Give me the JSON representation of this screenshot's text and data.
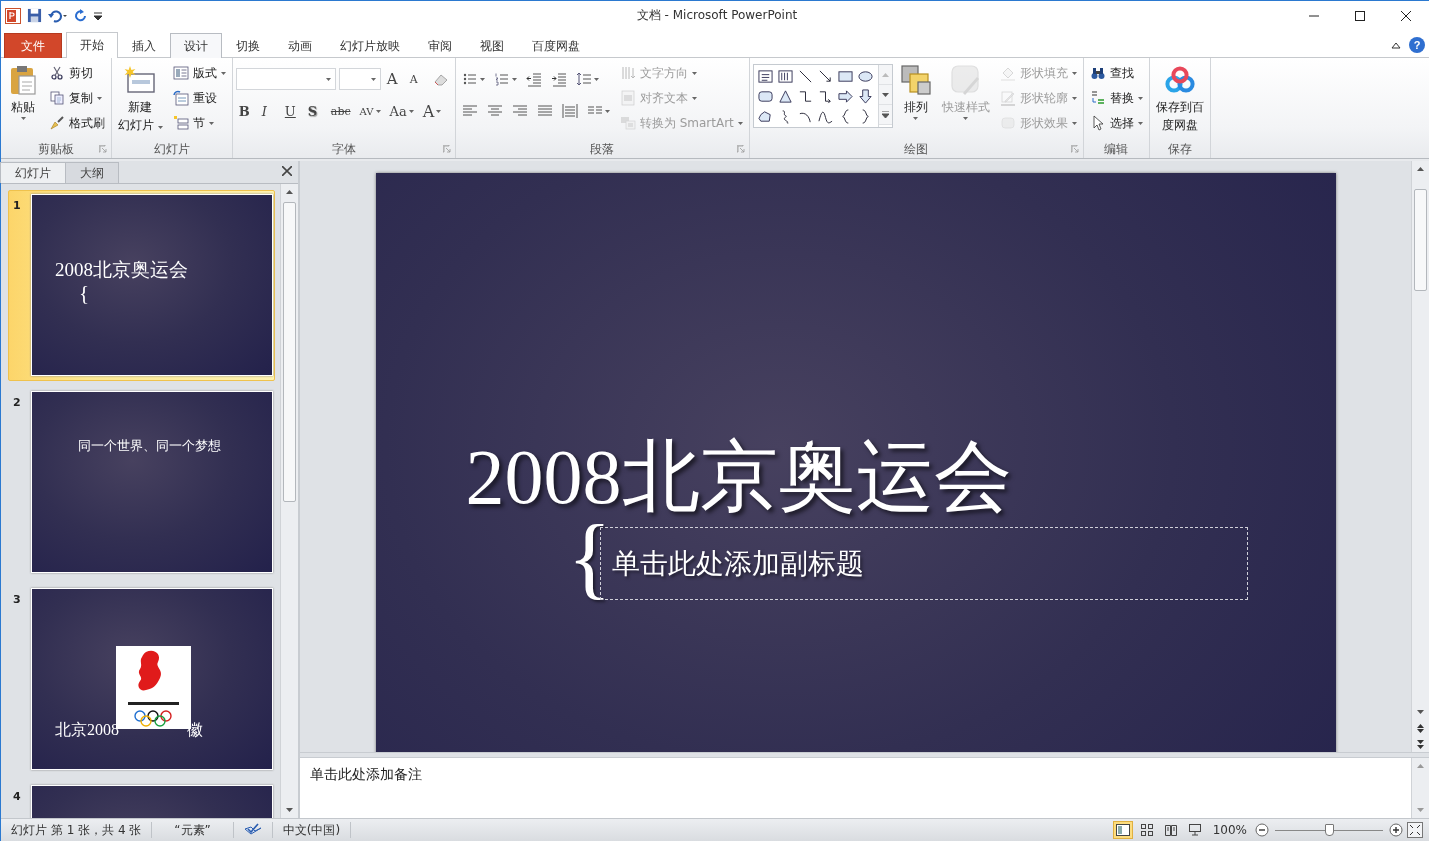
{
  "window": {
    "title": "文档 - Microsoft PowerPoint",
    "help": "?"
  },
  "tabs": [
    {
      "label": "文件",
      "kind": "file",
      "selected": false,
      "hovered": false
    },
    {
      "label": "开始",
      "kind": "tab",
      "selected": true,
      "hovered": false
    },
    {
      "label": "插入",
      "kind": "tab",
      "selected": false,
      "hovered": false
    },
    {
      "label": "设计",
      "kind": "tab",
      "selected": false,
      "hovered": true
    },
    {
      "label": "切换",
      "kind": "tab",
      "selected": false,
      "hovered": false
    },
    {
      "label": "动画",
      "kind": "tab",
      "selected": false,
      "hovered": false
    },
    {
      "label": "幻灯片放映",
      "kind": "tab",
      "selected": false,
      "hovered": false
    },
    {
      "label": "审阅",
      "kind": "tab",
      "selected": false,
      "hovered": false
    },
    {
      "label": "视图",
      "kind": "tab",
      "selected": false,
      "hovered": false
    },
    {
      "label": "百度网盘",
      "kind": "tab",
      "selected": false,
      "hovered": false
    }
  ],
  "ribbon": {
    "groups": [
      {
        "label": "剪贴板",
        "launcher": true,
        "items": [
          {
            "kind": "large",
            "lines": [
              "粘贴"
            ],
            "dropdown": true,
            "disabled": false
          },
          {
            "kind": "small",
            "label": "剪切",
            "dropdown": false,
            "disabled": false
          },
          {
            "kind": "small",
            "label": "复制",
            "dropdown": true,
            "disabled": false
          },
          {
            "kind": "small",
            "label": "格式刷",
            "dropdown": false,
            "disabled": false
          }
        ]
      },
      {
        "label": "幻灯片",
        "launcher": false,
        "items": [
          {
            "kind": "large",
            "lines": [
              "新建",
              "幻灯片"
            ],
            "dropdown": true,
            "disabled": false
          },
          {
            "kind": "small",
            "label": "版式",
            "dropdown": true,
            "disabled": false
          },
          {
            "kind": "small",
            "label": "重设",
            "dropdown": false,
            "disabled": false
          },
          {
            "kind": "small",
            "label": "节",
            "dropdown": true,
            "disabled": false
          }
        ]
      },
      {
        "label": "字体",
        "launcher": true,
        "upper": [
          {
            "kind": "font-field"
          },
          {
            "kind": "size-field"
          },
          {
            "kind": "grow",
            "label": "A"
          },
          {
            "kind": "shrink",
            "label": "A"
          },
          {
            "kind": "icon",
            "dropdown": false
          }
        ],
        "lower": [
          {
            "kind": "bold",
            "label": "B"
          },
          {
            "kind": "italic",
            "label": "I"
          },
          {
            "kind": "underline",
            "label": "U"
          },
          {
            "kind": "shadow",
            "label": "S"
          },
          {
            "kind": "strike",
            "label": "abc"
          },
          {
            "kind": "spacing",
            "label": "AV"
          },
          {
            "kind": "case",
            "label": "Aa"
          },
          {
            "kind": "color",
            "label": "A"
          }
        ]
      },
      {
        "label": "段落",
        "launcher": true,
        "upper": [
          {
            "kind": "icon",
            "dropdown": true
          },
          {
            "kind": "icon",
            "dropdown": true
          },
          {
            "kind": "icon",
            "dropdown": false
          },
          {
            "kind": "icon",
            "dropdown": false
          },
          {
            "kind": "icon",
            "dropdown": true
          }
        ],
        "lower": [
          {
            "kind": "icon",
            "dropdown": false
          },
          {
            "kind": "icon",
            "dropdown": false
          },
          {
            "kind": "icon",
            "dropdown": false
          },
          {
            "kind": "icon",
            "dropdown": false
          },
          {
            "kind": "icon",
            "dropdown": false
          },
          {
            "kind": "icon",
            "dropdown": true
          }
        ],
        "items": [
          {
            "kind": "small",
            "label": "文字方向",
            "dropdown": true,
            "disabled": true
          },
          {
            "kind": "small",
            "label": "对齐文本",
            "dropdown": true,
            "disabled": true
          },
          {
            "kind": "small",
            "label": "转换为 SmartArt",
            "dropdown": true,
            "disabled": true
          }
        ]
      },
      {
        "label": "绘图",
        "launcher": true,
        "gallery": true,
        "items": [
          {
            "kind": "large",
            "lines": [
              "排列"
            ],
            "dropdown": true,
            "disabled": false
          },
          {
            "kind": "large",
            "lines": [
              "快速样式"
            ],
            "dropdown": true,
            "disabled": true
          },
          {
            "kind": "small",
            "label": "形状填充",
            "dropdown": true,
            "disabled": true
          },
          {
            "kind": "small",
            "label": "形状轮廓",
            "dropdown": true,
            "disabled": true
          },
          {
            "kind": "small",
            "label": "形状效果",
            "dropdown": true,
            "disabled": true
          }
        ]
      },
      {
        "label": "编辑",
        "launcher": false,
        "items": [
          {
            "kind": "small",
            "label": "查找",
            "dropdown": false,
            "disabled": false
          },
          {
            "kind": "small",
            "label": "替换",
            "dropdown": true,
            "disabled": false
          },
          {
            "kind": "small",
            "label": "选择",
            "dropdown": true,
            "disabled": false
          }
        ]
      },
      {
        "label": "保存",
        "launcher": false,
        "items": [
          {
            "kind": "large",
            "lines": [
              "保存到百",
              "度网盘"
            ],
            "dropdown": false,
            "disabled": false
          }
        ]
      }
    ]
  },
  "pane_tabs": [
    {
      "label": "幻灯片",
      "selected": true
    },
    {
      "label": "大纲",
      "selected": false
    }
  ],
  "slides": [
    {
      "number": "1",
      "kind": "title",
      "selected": true,
      "title": "2008北京奥运会",
      "brace": "{"
    },
    {
      "number": "2",
      "kind": "text",
      "selected": false,
      "text": "同一个世界、同一个梦想"
    },
    {
      "number": "3",
      "kind": "picture",
      "selected": false,
      "text_parts": [
        "北京2008",
        "徽"
      ]
    },
    {
      "number": "4",
      "kind": "blank",
      "selected": false
    }
  ],
  "slide": {
    "title": "2008北京奥运会",
    "brace": "{",
    "subtitle_placeholder": "单击此处添加副标题"
  },
  "notes": {
    "placeholder": "单击此处添加备注"
  },
  "status_bar": {
    "slide_info": "幻灯片 第 1 张，共 4 张",
    "theme": "“元素”",
    "language": "中文(中国)",
    "views": [
      {
        "selected": true
      },
      {
        "selected": false
      },
      {
        "selected": false
      },
      {
        "selected": false
      }
    ],
    "zoom": "100%",
    "zoom_slider": {
      "level": 0.5
    }
  }
}
